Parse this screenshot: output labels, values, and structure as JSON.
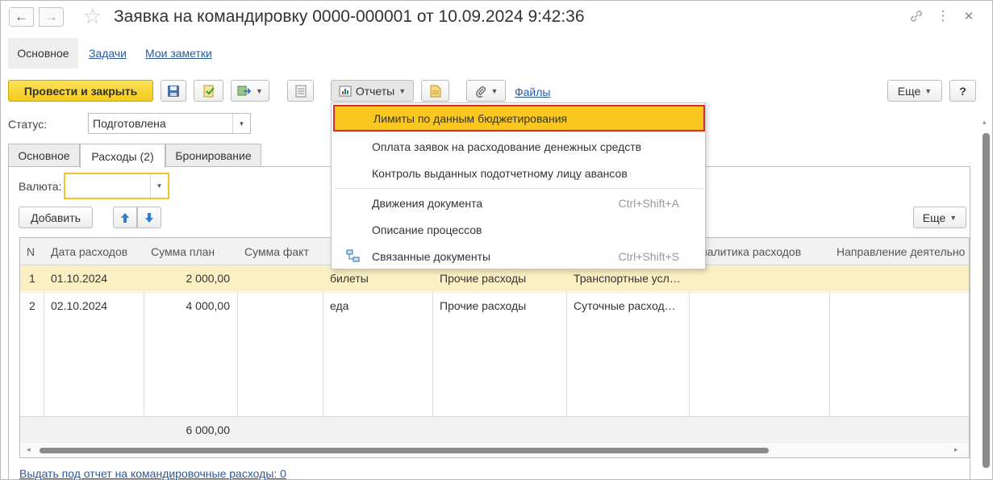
{
  "window": {
    "title": "Заявка на командировку 0000-000001 от 10.09.2024 9:42:36"
  },
  "top_tabs": {
    "main": "Основное",
    "tasks": "Задачи",
    "notes": "Мои заметки"
  },
  "toolbar": {
    "post_close": "Провести и закрыть",
    "reports": "Отчеты",
    "files": "Файлы",
    "more": "Еще",
    "help": "?"
  },
  "status": {
    "label": "Статус:",
    "value": "Подготовлена"
  },
  "inner_tabs": {
    "main": "Основное",
    "expenses": "Расходы (2)",
    "booking": "Бронирование"
  },
  "expenses_panel": {
    "currency_label": "Валюта:",
    "currency_value": "",
    "add_button": "Добавить",
    "more": "Еще"
  },
  "table": {
    "headers": [
      "N",
      "Дата расходов",
      "Сумма план",
      "Сумма факт",
      "",
      "",
      "",
      "налитика расходов",
      "Направление деятельно"
    ],
    "rows": [
      {
        "n": "1",
        "date": "01.10.2024",
        "plan": "2 000,00",
        "fact": "",
        "descr": "билеты",
        "type": "Прочие расходы",
        "item": "Транспортные усл…",
        "analytics": "",
        "direction": ""
      },
      {
        "n": "2",
        "date": "02.10.2024",
        "plan": "4 000,00",
        "fact": "",
        "descr": "еда",
        "type": "Прочие расходы",
        "item": "Суточные расход…",
        "analytics": "",
        "direction": ""
      }
    ],
    "total_plan": "6 000,00"
  },
  "bottom_link": "Выдать под отчет на командировочные расходы: 0",
  "reports_menu": {
    "items": [
      {
        "label": "Лимиты по данным бюджетирования",
        "shortcut": ""
      },
      {
        "label": "Оплата заявок на расходование денежных средств",
        "shortcut": ""
      },
      {
        "label": "Контроль выданных подотчетному лицу авансов",
        "shortcut": ""
      },
      {
        "label": "Движения документа",
        "shortcut": "Ctrl+Shift+A"
      },
      {
        "label": "Описание процессов",
        "shortcut": ""
      },
      {
        "label": "Связанные документы",
        "shortcut": "Ctrl+Shift+S"
      }
    ]
  },
  "colors": {
    "primary_button": "#f4cb1c",
    "link": "#2a5a9c",
    "selected_row": "#fbf0c4",
    "menu_highlight": "#f8c821",
    "highlight_border": "#d92b2b"
  }
}
